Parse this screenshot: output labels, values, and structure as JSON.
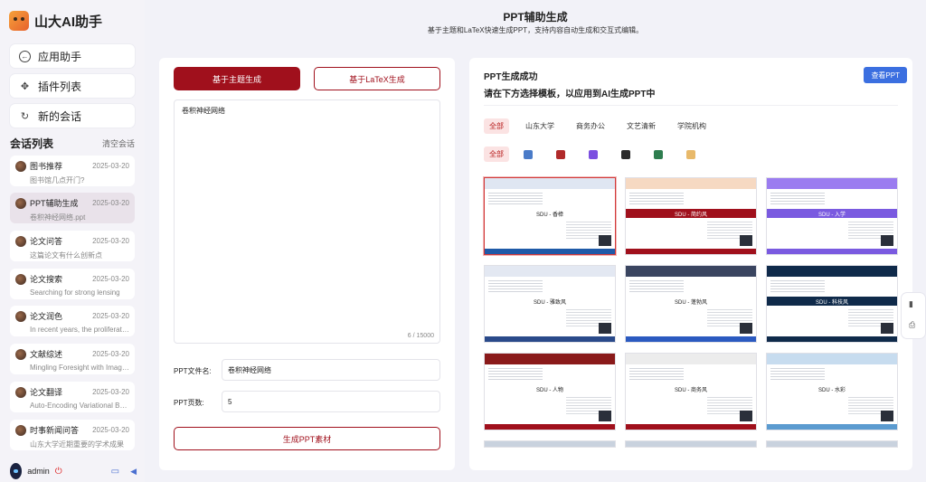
{
  "app": {
    "title": "山大AI助手"
  },
  "nav": {
    "app_assistant": "应用助手",
    "plugins": "插件列表",
    "new_chat": "新的会话"
  },
  "conversations": {
    "title": "会话列表",
    "clear_label": "清空会话",
    "items": [
      {
        "title": "图书推荐",
        "date": "2025-03-20",
        "subtitle": "图书馆几点开门?"
      },
      {
        "title": "PPT辅助生成",
        "date": "2025-03-20",
        "subtitle": "卷积神经网络.ppt"
      },
      {
        "title": "论文问答",
        "date": "2025-03-20",
        "subtitle": "这篇论文有什么创新点"
      },
      {
        "title": "论文搜索",
        "date": "2025-03-20",
        "subtitle": "Searching for strong lensing"
      },
      {
        "title": "论文润色",
        "date": "2025-03-20",
        "subtitle": "In recent years, the proliferation ..."
      },
      {
        "title": "文献综述",
        "date": "2025-03-20",
        "subtitle": "Mingling Foresight with Imaginat..."
      },
      {
        "title": "论文翻译",
        "date": "2025-03-20",
        "subtitle": "Auto-Encoding Variational Baye..."
      },
      {
        "title": "时事新闻问答",
        "date": "2025-03-20",
        "subtitle": "山东大学近期重要的学术成果"
      }
    ]
  },
  "user": {
    "name": "admin"
  },
  "header": {
    "title": "PPT辅助生成",
    "subtitle": "基于主题和LaTeX快速生成PPT，支持内容自动生成和交互式编辑。"
  },
  "form": {
    "tab_topic": "基于主题生成",
    "tab_latex": "基于LaTeX生成",
    "topic_text": "卷积神经网络",
    "char_counter": "6 / 15000",
    "filename_label": "PPT文件名:",
    "filename_value": "卷积神经网络",
    "pages_label": "PPT页数:",
    "pages_value": "5",
    "generate_label": "生成PPT素材"
  },
  "result": {
    "title": "PPT生成成功",
    "hint": "请在下方选择模板，以应用到AI生成PPT中",
    "view_button": "查看PPT",
    "categories": [
      "全部",
      "山东大学",
      "商务办公",
      "文艺清新",
      "学院机构"
    ],
    "color_filter_all": "全部",
    "swatch_colors": [
      "#4a7bc8",
      "#b02a2a",
      "#7b4fe0",
      "#2a2a2a",
      "#2e7d4f",
      "#e8b96a"
    ],
    "templates": [
      {
        "name": "SDU - 香樟",
        "top": "#dfe6f2",
        "mid": "#ffffff",
        "bot": "#1f5aa8"
      },
      {
        "name": "SDU - 简约风",
        "top": "#f6d9c2",
        "mid": "#a0101c",
        "bot": "#a0101c"
      },
      {
        "name": "SDU - 入学",
        "top": "#9b7cf0",
        "mid": "#7a5ae0",
        "bot": "#7a5ae0"
      },
      {
        "name": "SDU - 雅致风",
        "top": "#e3e8f2",
        "mid": "#ffffff",
        "bot": "#2a4a8a"
      },
      {
        "name": "SDU - 蓬勃风",
        "top": "#3a4560",
        "mid": "#ffffff",
        "bot": "#2b5ac0"
      },
      {
        "name": "SDU - 科技风",
        "top": "#0f2a4a",
        "mid": "#0f2a4a",
        "bot": "#0f2a4a"
      },
      {
        "name": "SDU - 人物",
        "top": "#8a1a1a",
        "mid": "#ffffff",
        "bot": "#a0101c"
      },
      {
        "name": "SDU - 商务风",
        "top": "#ececec",
        "mid": "#ffffff",
        "bot": "#a0101c"
      },
      {
        "name": "SDU - 水彩",
        "top": "#c7dcef",
        "mid": "#ffffff",
        "bot": "#5b9bd0"
      }
    ]
  }
}
